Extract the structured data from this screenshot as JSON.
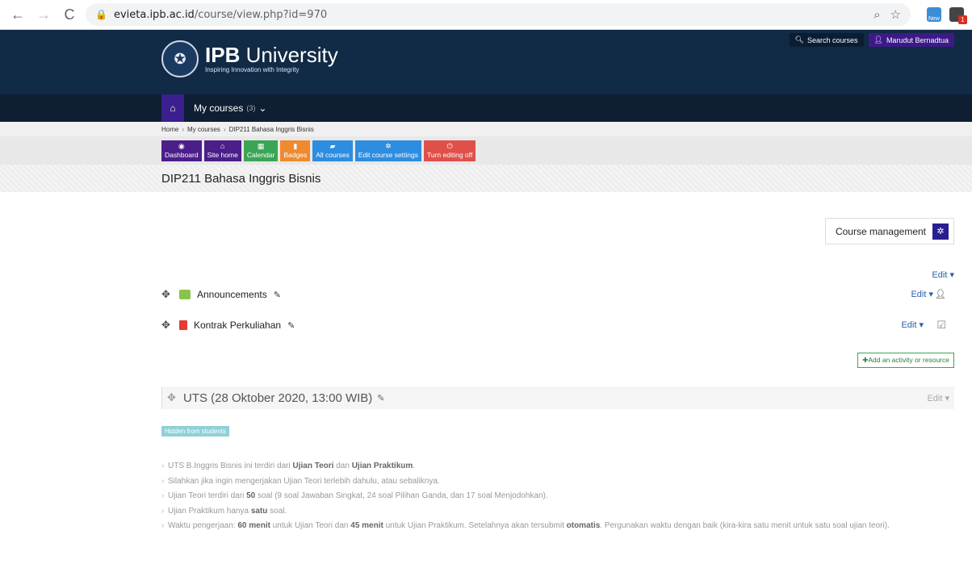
{
  "browser": {
    "url_domain": "evieta.ipb.ac.id",
    "url_path": "/course/view.php?id=970",
    "new_badge": "New",
    "ext_badge": "1"
  },
  "header": {
    "brand_bold": "IPB",
    "brand_rest": " University",
    "tagline": "Inspiring Innovation with Integrity",
    "search_label": "Search courses",
    "user_name": "Marudut Bernadtua"
  },
  "navbar": {
    "mycourses_label": "My courses",
    "mycourses_count": "(3)"
  },
  "breadcrumb": {
    "items": [
      "Home",
      "My courses",
      "DIP211 Bahasa Inggris Bisnis"
    ]
  },
  "quickbar": {
    "dashboard": "Dashboard",
    "sitehome": "Site home",
    "calendar": "Calendar",
    "badges": "Badges",
    "allcourses": "All courses",
    "editsettings": "Edit course settings",
    "editingoff": "Turn editing off"
  },
  "page": {
    "title": "DIP211 Bahasa Inggris Bisnis",
    "course_management": "Course management",
    "edit_label": "Edit",
    "add_activity": "Add an activity or resource"
  },
  "activities": [
    {
      "name": "Announcements"
    },
    {
      "name": "Kontrak Perkuliahan"
    }
  ],
  "section": {
    "title": "UTS (28 Oktober 2020, 13:00 WIB)",
    "hidden_badge": "Hidden from students",
    "bullets": {
      "b1_pre": "UTS B.Inggris Bisnis ini terdiri dari ",
      "b1_a": "Ujian Teori",
      "b1_mid": " dan ",
      "b1_b": "Ujian Praktikum",
      "b1_end": ".",
      "b2": "Silahkan jika ingin mengerjakan Ujian Teori terlebih dahulu, atau sebaliknya.",
      "b3_pre": "Ujian Teori terdiri dari ",
      "b3_num": "50",
      "b3_end": " soal (9 soal Jawaban Singkat, 24 soal Pilihan Ganda, dan 17 soal Menjodohkan).",
      "b4_pre": "Ujian Praktikum hanya ",
      "b4_num": "satu",
      "b4_end": " soal.",
      "b5_pre": "Waktu pengerjaan: ",
      "b5_a": "60 menit",
      "b5_mid": " untuk Ujian Teori dan ",
      "b5_b": "45 menit",
      "b5_mid2": " untuk Ujian Praktikum. Setelahnya akan tersubmit ",
      "b5_c": "otomatis",
      "b5_end": ". Pergunakan waktu dengan baik (kira-kira satu menit untuk satu soal ujian teori)."
    }
  }
}
